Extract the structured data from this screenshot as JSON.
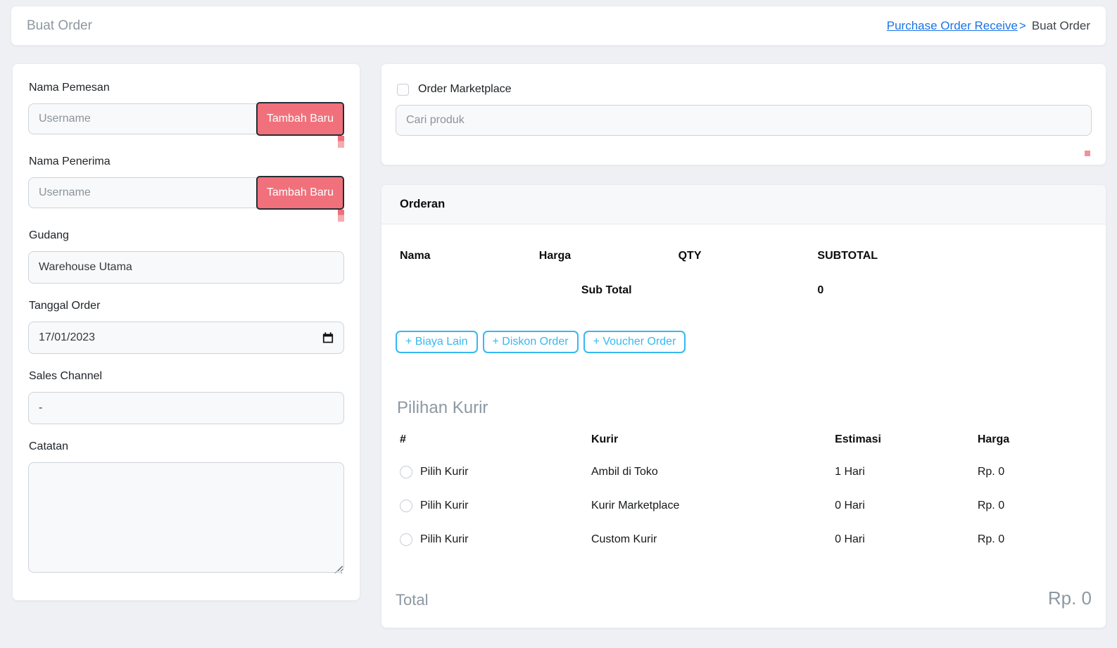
{
  "page": {
    "title": "Buat Order"
  },
  "breadcrumb": {
    "link": "Purchase Order Receive",
    "separator": ">",
    "current": "Buat Order"
  },
  "left_form": {
    "nama_pemesan": {
      "label": "Nama Pemesan",
      "placeholder": "Username",
      "button_label": "Tambah Baru"
    },
    "nama_penerima": {
      "label": "Nama Penerima",
      "placeholder": "Username",
      "button_label": "Tambah Baru"
    },
    "gudang": {
      "label": "Gudang",
      "value": "Warehouse Utama"
    },
    "tanggal_order": {
      "label": "Tanggal Order",
      "value": "17/01/2023"
    },
    "sales_channel": {
      "label": "Sales Channel",
      "value": "-"
    },
    "catatan": {
      "label": "Catatan",
      "value": ""
    }
  },
  "marketplace": {
    "checkbox_label": "Order Marketplace",
    "checked": false,
    "search_placeholder": "Cari produk"
  },
  "orderan": {
    "title": "Orderan",
    "columns": [
      "Nama",
      "Harga",
      "QTY",
      "SUBTOTAL"
    ],
    "subtotal_label": "Sub Total",
    "subtotal_value": "0",
    "actions": [
      "+ Biaya Lain",
      "+ Diskon Order",
      "+ Voucher Order"
    ]
  },
  "kurir": {
    "title": "Pilihan Kurir",
    "columns": [
      "#",
      "Kurir",
      "Estimasi",
      "Harga"
    ],
    "rows": [
      {
        "pilih": "Pilih Kurir",
        "kurir": "Ambil di Toko",
        "estimasi": "1 Hari",
        "harga": "Rp. 0"
      },
      {
        "pilih": "Pilih Kurir",
        "kurir": "Kurir Marketplace",
        "estimasi": "0 Hari",
        "harga": "Rp. 0"
      },
      {
        "pilih": "Pilih Kurir",
        "kurir": "Custom Kurir",
        "estimasi": "0 Hari",
        "harga": "Rp. 0"
      }
    ]
  },
  "total": {
    "label": "Total",
    "value": "Rp. 0"
  },
  "colors": {
    "page_background": "#eef0f4",
    "button_red": "#f0717c",
    "button_red_border": "#272d33",
    "accent_cyan": "#35b9f1",
    "link_blue": "#1a73e8",
    "heading_gray": "#8d98a2",
    "pink_fragment": "#ef939b"
  }
}
